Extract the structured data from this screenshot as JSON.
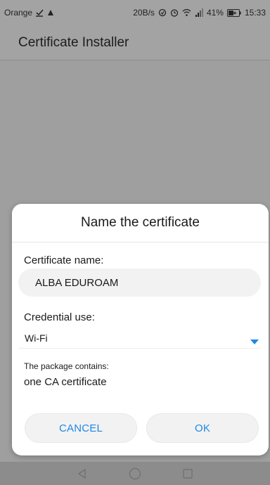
{
  "status_bar": {
    "carrier": "Orange",
    "speed": "20B/s",
    "battery": "41%",
    "time": "15:33"
  },
  "app": {
    "title": "Certificate Installer"
  },
  "dialog": {
    "title": "Name the certificate",
    "name_label": "Certificate name:",
    "name_value": "ALBA EDUROAM",
    "credential_label": "Credential use:",
    "credential_selected": "Wi-Fi",
    "package_label": "The package contains:",
    "package_value": "one CA certificate",
    "cancel_label": "CANCEL",
    "ok_label": "OK"
  },
  "colors": {
    "accent": "#1e88e5"
  },
  "icons": [
    "checkmark-download-icon",
    "usb-debug-icon",
    "wifi-icon",
    "signal-icon",
    "alarm-icon",
    "battery-icon",
    "back-icon",
    "home-icon",
    "recents-icon",
    "dropdown-arrow-icon"
  ]
}
